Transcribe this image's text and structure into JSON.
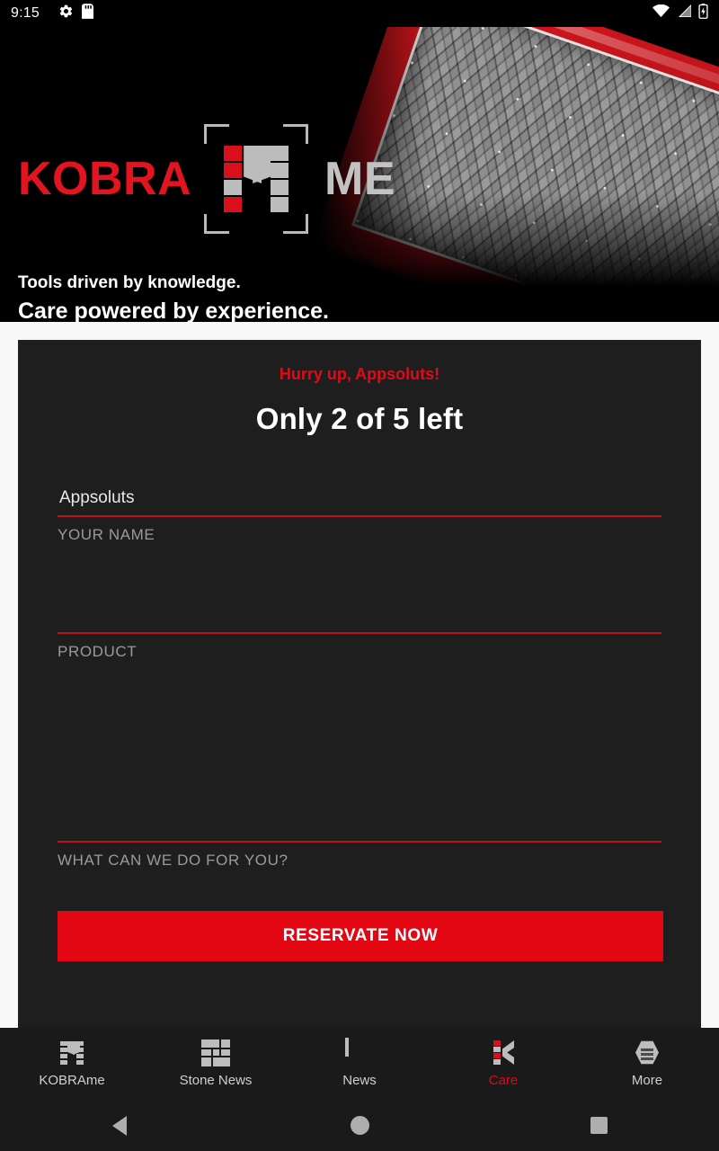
{
  "status_bar": {
    "time": "9:15",
    "left_icons": [
      "gear-icon",
      "sd-card-icon"
    ],
    "right_icons": [
      "wifi-icon",
      "cellular-signal-icon",
      "battery-charging-icon"
    ]
  },
  "header": {
    "logo_kobra": "KOBRA",
    "logo_me": "ME",
    "logo_mark": "kobrame-m-logo-icon",
    "tagline_1": "Tools driven by knowledge.",
    "tagline_2": "Care powered by experience.",
    "hero_image": "red-framed-honeycomb-tray-photo"
  },
  "form": {
    "promo": "Hurry up, Appsoluts!",
    "headline": "Only 2 of 5 left",
    "fields": [
      {
        "value": "Appsoluts",
        "label": "YOUR NAME",
        "placeholder": ""
      },
      {
        "value": "",
        "label": "PRODUCT",
        "placeholder": ""
      },
      {
        "value": "",
        "label": "WHAT CAN WE DO FOR YOU?",
        "placeholder": ""
      }
    ],
    "submit_label": "RESERVATE NOW"
  },
  "bottom_nav": {
    "items": [
      {
        "label": "KOBRAme",
        "icon": "kobrame-m-icon",
        "active": false
      },
      {
        "label": "Stone News",
        "icon": "stone-grid-icon",
        "active": false
      },
      {
        "label": "News",
        "icon": "newspaper-icon",
        "active": false
      },
      {
        "label": "Care",
        "icon": "care-k-icon",
        "active": true
      },
      {
        "label": "More",
        "icon": "hexagon-menu-icon",
        "active": false
      }
    ]
  },
  "system_nav": {
    "back": "back-triangle-icon",
    "home": "home-circle-icon",
    "recents": "recents-square-icon"
  },
  "colors": {
    "brand_red": "#e30613",
    "logo_red": "#e1141f",
    "card_bg": "#1e1e1e",
    "page_bg": "#f8f8f8",
    "header_bg": "#000000",
    "nav_bg": "#1a1a1a",
    "label_gray": "#9a9a9a"
  }
}
